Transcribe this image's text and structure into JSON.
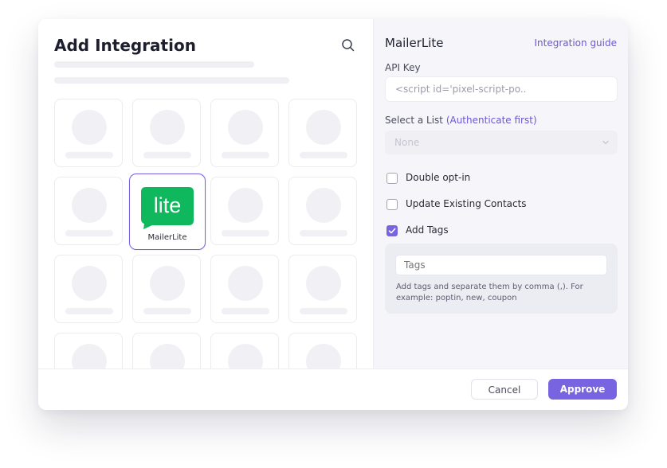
{
  "left": {
    "title": "Add Integration",
    "selected_card": {
      "label": "MailerLite",
      "logo_text": "lite"
    }
  },
  "right": {
    "title": "MailerLite",
    "guide_link": "Integration guide",
    "api_key": {
      "label": "API Key",
      "value": "<script id='pixel-script-po.."
    },
    "list": {
      "label": "Select a List",
      "hint": "(Authenticate first)",
      "selected": "None"
    },
    "checkboxes": [
      {
        "label": "Double opt-in",
        "checked": false
      },
      {
        "label": "Update Existing Contacts",
        "checked": false
      },
      {
        "label": "Add Tags",
        "checked": true
      }
    ],
    "tags": {
      "placeholder": "Tags",
      "help": "Add tags and separate them by comma (,). For example: poptin, new, coupon"
    }
  },
  "footer": {
    "cancel": "Cancel",
    "approve": "Approve"
  },
  "colors": {
    "accent": "#7863e0",
    "logo_green": "#0fb85c"
  },
  "icons": [
    "search-icon",
    "chevron-down-icon",
    "check-icon"
  ]
}
